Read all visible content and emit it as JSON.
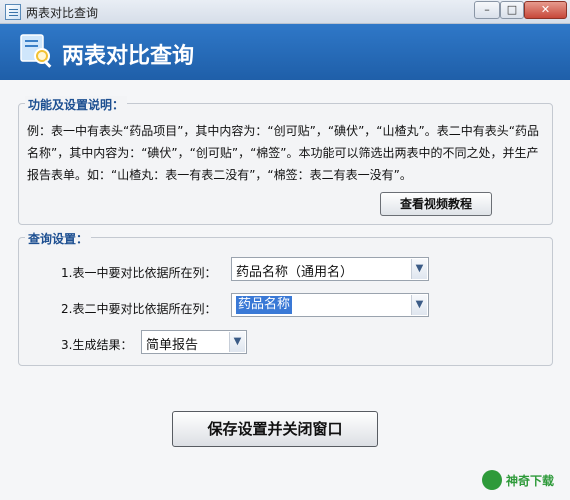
{
  "window": {
    "title": "两表对比查询",
    "minimize_label": "–",
    "maximize_label": "□",
    "close_label": "✕"
  },
  "header": {
    "title": "两表对比查询",
    "icon": "magnifier-document-icon"
  },
  "info_group": {
    "title": "功能及设置说明：",
    "description": "例：表一中有表头“药品项目”，其中内容为：“创可贴”，“碘伏”，“山楂丸”。表二中有表头“药品名称”，其中内容为：“碘伏”，“创可贴”，“棉签”。本功能可以筛选出两表中的不同之处，并生产报告表单。如：“山楂丸：表一有表二没有”，“棉签：表二有表一没有”。",
    "video_button": "查看视频教程"
  },
  "query_group": {
    "title": "查询设置：",
    "row1_label": "1.表一中要对比依据所在列：",
    "row1_value": "药品名称（通用名）",
    "row2_label": "2.表二中要对比依据所在列：",
    "row2_value": "药品名称",
    "row3_label": "3.生成结果：",
    "row3_value": "简单报告"
  },
  "save_button": "保存设置并关闭窗口",
  "watermark": "神奇下载"
}
